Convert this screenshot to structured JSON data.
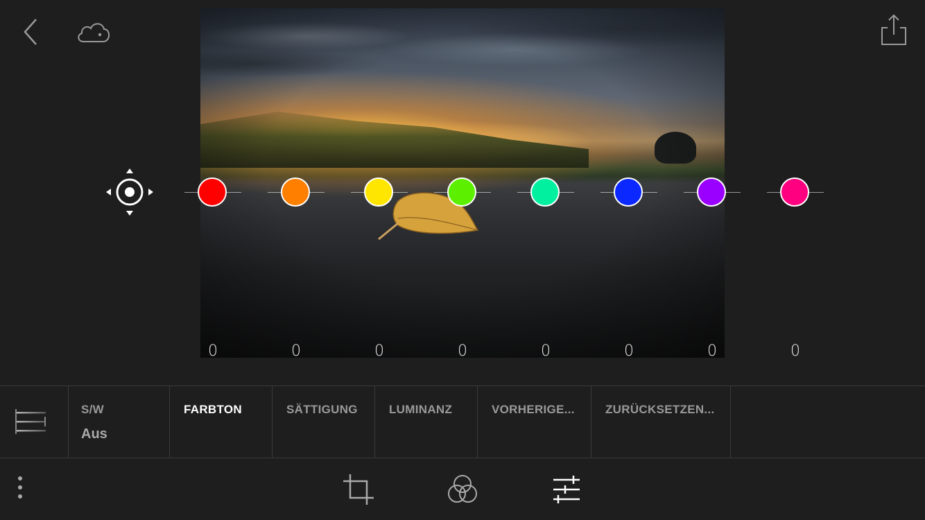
{
  "top_bar": {
    "back_icon": "chevron-left-icon",
    "cloud_icon": "cloud-sync-icon",
    "share_icon": "share-icon"
  },
  "color_mixer": {
    "target_tool_icon": "target-adjust-icon",
    "swatches": [
      {
        "name": "red",
        "color": "#ff0000",
        "value": "0"
      },
      {
        "name": "orange",
        "color": "#ff7f00",
        "value": "0"
      },
      {
        "name": "yellow",
        "color": "#ffe600",
        "value": "0"
      },
      {
        "name": "green",
        "color": "#5cf000",
        "value": "0"
      },
      {
        "name": "aqua",
        "color": "#00f0a0",
        "value": "0"
      },
      {
        "name": "blue",
        "color": "#0a28ff",
        "value": "0"
      },
      {
        "name": "purple",
        "color": "#9a00ff",
        "value": "0"
      },
      {
        "name": "magenta",
        "color": "#ff0080",
        "value": "0"
      }
    ]
  },
  "tabs": {
    "menu_icon": "list-icon",
    "sw": {
      "label": "S/W",
      "value": "Aus"
    },
    "farbton": {
      "label": "FARBTON",
      "active": true
    },
    "saettigung": {
      "label": "SÄTTIGUNG"
    },
    "luminanz": {
      "label": "LUMINANZ"
    },
    "vorherige": {
      "label": "VORHERIGE..."
    },
    "zuruecksetzen": {
      "label": "ZURÜCKSETZEN..."
    }
  },
  "bottom_toolbar": {
    "more_icon": "more-vertical-icon",
    "crop_icon": "crop-icon",
    "presets_icon": "color-circles-icon",
    "adjust_icon": "sliders-icon"
  }
}
